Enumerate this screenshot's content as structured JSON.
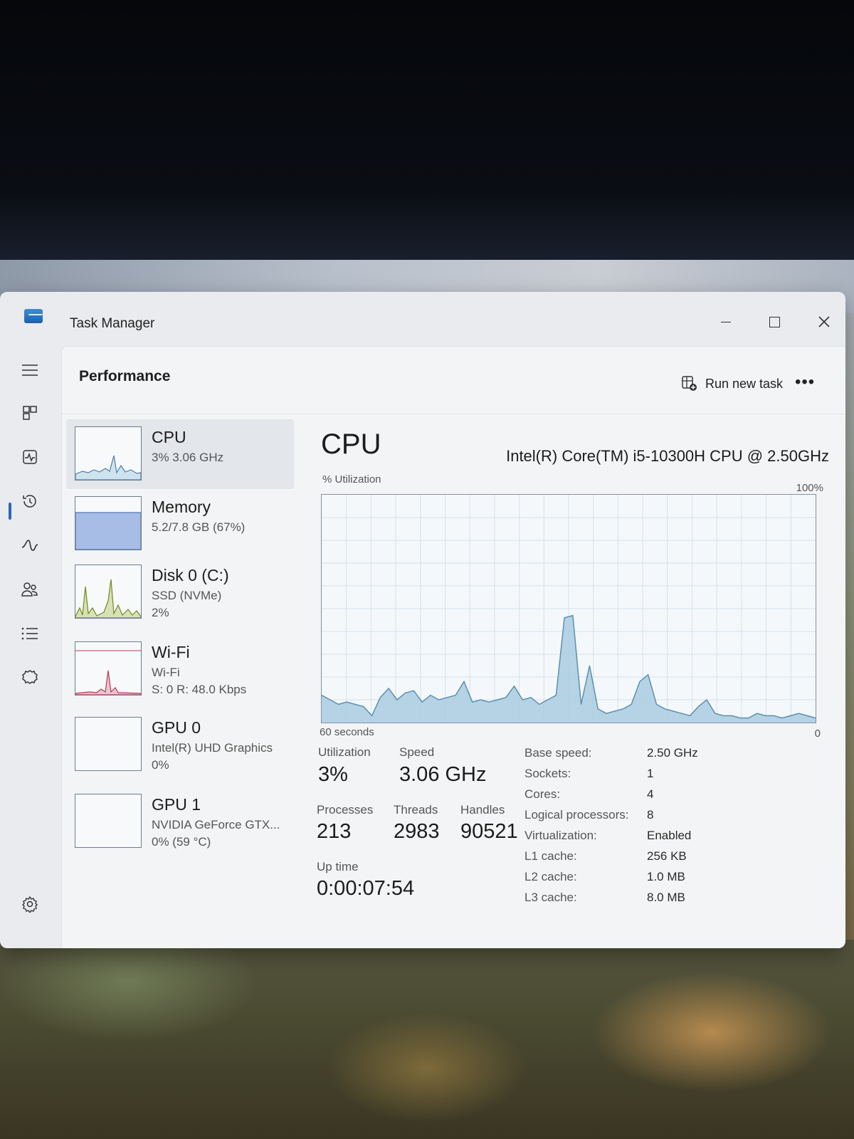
{
  "window": {
    "title": "Task Manager"
  },
  "header": {
    "page_title": "Performance",
    "run_new_task": "Run new task",
    "more": "•••"
  },
  "sidebar": [
    {
      "name": "CPU",
      "sub1": "3%  3.06 GHz",
      "sub2": ""
    },
    {
      "name": "Memory",
      "sub1": "5.2/7.8 GB (67%)",
      "sub2": ""
    },
    {
      "name": "Disk 0 (C:)",
      "sub1": "SSD (NVMe)",
      "sub2": "2%"
    },
    {
      "name": "Wi-Fi",
      "sub1": "Wi-Fi",
      "sub2": "S: 0  R: 48.0 Kbps"
    },
    {
      "name": "GPU 0",
      "sub1": "Intel(R) UHD Graphics",
      "sub2": "0%"
    },
    {
      "name": "GPU 1",
      "sub1": "NVIDIA GeForce GTX...",
      "sub2": "0%  (59 °C)"
    }
  ],
  "main": {
    "title": "CPU",
    "model": "Intel(R) Core(TM) i5-10300H CPU @ 2.50GHz",
    "graph_label": "% Utilization",
    "graph_max": "100%",
    "graph_xlabel": "60 seconds",
    "graph_min": "0",
    "utilization": [
      12,
      10,
      8,
      9,
      8,
      7,
      3,
      11,
      15,
      10,
      13,
      14,
      9,
      12,
      10,
      11,
      12,
      18,
      9,
      10,
      9,
      10,
      11,
      16,
      10,
      11,
      8,
      10,
      12,
      46,
      47,
      8,
      25,
      6,
      4,
      5,
      6,
      8,
      18,
      21,
      8,
      6,
      5,
      4,
      3,
      7,
      10,
      4,
      3,
      3,
      2,
      2,
      4,
      3,
      3,
      2,
      3,
      4,
      3,
      2
    ]
  },
  "stats": {
    "utilization_label": "Utilization",
    "utilization": "3%",
    "speed_label": "Speed",
    "speed": "3.06 GHz",
    "processes_label": "Processes",
    "processes": "213",
    "threads_label": "Threads",
    "threads": "2983",
    "handles_label": "Handles",
    "handles": "90521",
    "uptime_label": "Up time",
    "uptime": "0:00:07:54"
  },
  "specs": [
    {
      "key": "Base speed:",
      "value": "2.50 GHz"
    },
    {
      "key": "Sockets:",
      "value": "1"
    },
    {
      "key": "Cores:",
      "value": "4"
    },
    {
      "key": "Logical processors:",
      "value": "8"
    },
    {
      "key": "Virtualization:",
      "value": "Enabled"
    },
    {
      "key": "L1 cache:",
      "value": "256 KB"
    },
    {
      "key": "L2 cache:",
      "value": "1.0 MB"
    },
    {
      "key": "L3 cache:",
      "value": "8.0 MB"
    }
  ],
  "colors": {
    "accent": "#2b66b9",
    "graph_fill": "#a9cde0",
    "graph_line": "#5d8fb0",
    "memory_fill": "#a7bde6",
    "disk_line": "#6f8a1f",
    "wifi_line": "#b53a55"
  },
  "icons": [
    "hamburger-icon",
    "processes-icon",
    "performance-icon",
    "app-history-icon",
    "startup-apps-icon",
    "users-icon",
    "details-icon",
    "services-icon",
    "settings-icon"
  ]
}
